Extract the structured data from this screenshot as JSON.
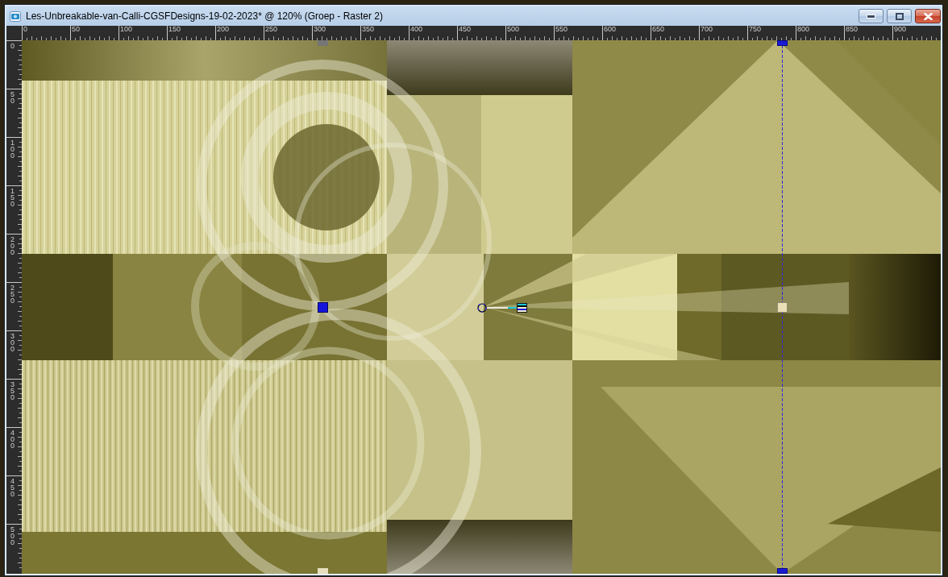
{
  "window": {
    "title": "Les-Unbreakable-van-Calli-CGSFDesigns-19-02-2023* @ 120% (Groep - Raster 2)"
  },
  "rulers": {
    "horizontal": [
      "0",
      "50",
      "100",
      "150",
      "200",
      "250",
      "300",
      "350",
      "400",
      "450",
      "500",
      "550",
      "600",
      "650",
      "700",
      "750",
      "800",
      "850",
      "900"
    ],
    "vertical": [
      "0",
      "50",
      "100",
      "150",
      "200",
      "250",
      "300",
      "350",
      "400",
      "450",
      "500"
    ]
  }
}
